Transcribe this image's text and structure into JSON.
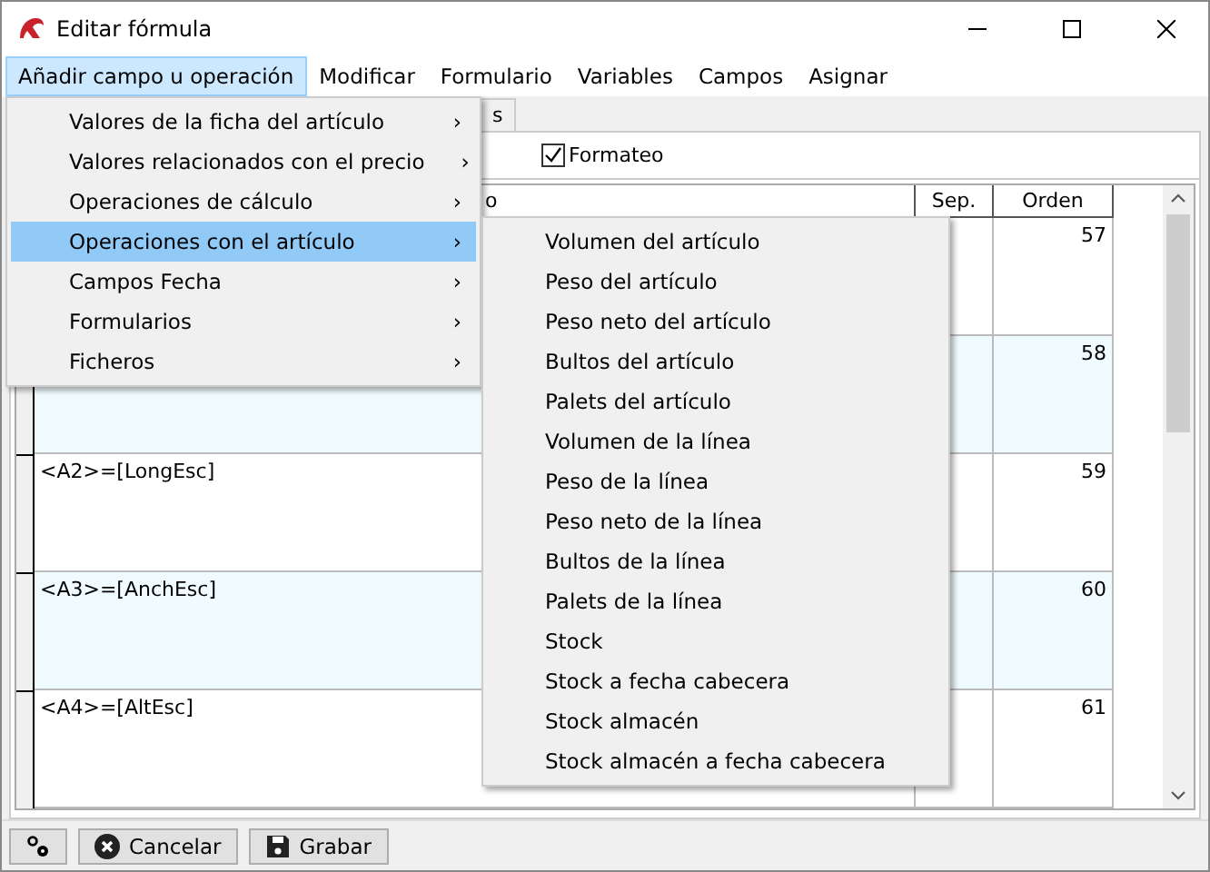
{
  "window": {
    "title": "Editar fórmula"
  },
  "menubar": [
    {
      "label": "Añadir campo u operación",
      "selected": true
    },
    {
      "label": "Modificar",
      "selected": false
    },
    {
      "label": "Formulario",
      "selected": false
    },
    {
      "label": "Variables",
      "selected": false
    },
    {
      "label": "Campos",
      "selected": false
    },
    {
      "label": "Asignar",
      "selected": false
    }
  ],
  "tab": {
    "label": "s"
  },
  "formatting": {
    "label": "Formateo",
    "checked": true
  },
  "table": {
    "columns": [
      "o",
      "Sep.",
      "Orden"
    ],
    "rows": [
      {
        "order": "57",
        "shaded": false
      },
      {
        "order": "58",
        "shaded": true
      },
      {
        "formula": "<A2>=[LongEsc]",
        "order": "59",
        "shaded": false
      },
      {
        "formula": "<A3>=[AnchEsc]",
        "order": "60",
        "shaded": true
      },
      {
        "formula": "<A4>=[AltEsc]",
        "order": "61",
        "shaded": false
      }
    ]
  },
  "menu": [
    {
      "label": "Valores de la ficha del artículo",
      "arrow": "›",
      "selected": false
    },
    {
      "label": "Valores relacionados con el precio",
      "arrow": "›",
      "selected": false
    },
    {
      "label": "Operaciones de cálculo",
      "arrow": "›",
      "selected": false
    },
    {
      "label": "Operaciones con el artículo",
      "arrow": "›",
      "selected": true
    },
    {
      "label": "Campos Fecha",
      "arrow": "›",
      "selected": false
    },
    {
      "label": "Formularios",
      "arrow": "›",
      "selected": false
    },
    {
      "label": "Ficheros",
      "arrow": "›",
      "selected": false
    }
  ],
  "submenu": [
    "Volumen del artículo",
    "Peso del artículo",
    "Peso neto del artículo",
    "Bultos del artículo",
    "Palets del artículo",
    "Volumen de la línea",
    "Peso de la línea",
    "Peso neto de la línea",
    "Bultos de la línea",
    "Palets de la línea",
    "Stock",
    "Stock a fecha cabecera",
    "Stock almacén",
    "Stock almacén a fecha cabecera"
  ],
  "buttons": [
    {
      "kind": "settings"
    },
    {
      "kind": "cancel",
      "label": "Cancelar"
    },
    {
      "kind": "save",
      "label": "Grabar"
    }
  ]
}
